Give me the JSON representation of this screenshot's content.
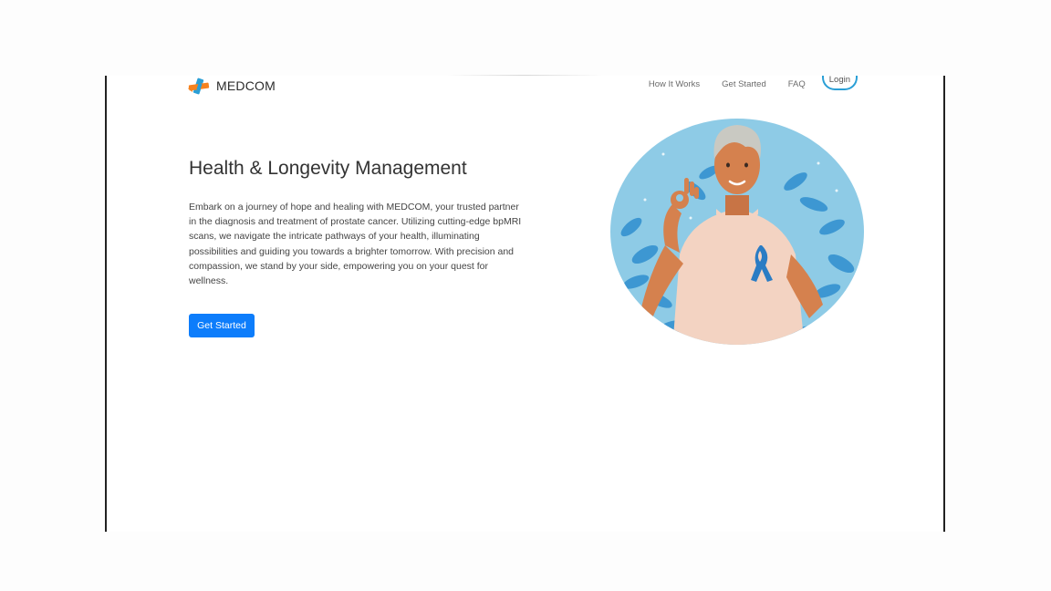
{
  "brand": {
    "name": "MEDCOM",
    "logo_icon": "medical-cross-logo-icon",
    "colors": {
      "orange": "#f5821f",
      "blue": "#2a9fd6"
    }
  },
  "nav": {
    "links": [
      "How It Works",
      "Get Started",
      "FAQ"
    ],
    "login_label": "Login"
  },
  "hero": {
    "title": "Health & Longevity Management",
    "description": "Embark on a journey of hope and healing with MEDCOM, your trusted partner in the diagnosis and treatment of prostate cancer. Utilizing cutting-edge bpMRI scans, we navigate the intricate pathways of your health, illuminating possibilities and guiding you towards a brighter tomorrow. With precision and compassion, we stand by your side, empowering you on your quest for wellness.",
    "cta_label": "Get Started",
    "cta_color": "#0d7dfb",
    "illustration": "man-with-blue-ribbon-illustration"
  }
}
